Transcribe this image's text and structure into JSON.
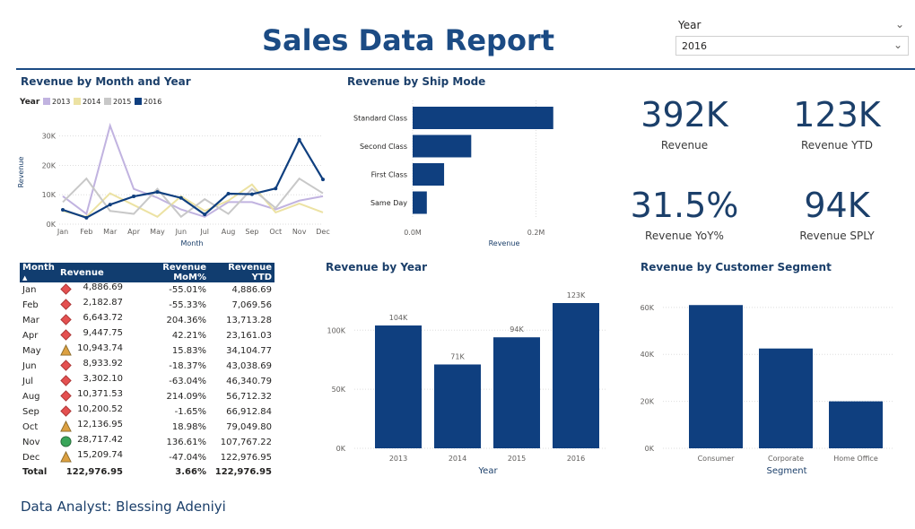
{
  "title": "Sales Data Report",
  "slicer": {
    "label": "Year",
    "value": "2016"
  },
  "analyst": "Data Analyst: Blessing Adeniyi",
  "kpis": [
    {
      "value": "392K",
      "label": "Revenue"
    },
    {
      "value": "123K",
      "label": "Revenue YTD"
    },
    {
      "value": "31.5%",
      "label": "Revenue YoY%"
    },
    {
      "value": "94K",
      "label": "Revenue SPLY"
    }
  ],
  "colors": {
    "primary": "#0f3f7f",
    "c2013": "#c1b3e0",
    "c2014": "#ece2a3",
    "c2015": "#c8c8c8",
    "c2016": "#0f3f7f",
    "red": "#e45050",
    "amber": "#dca041",
    "green": "#3aa65a"
  },
  "matrix": {
    "headers": [
      "Month",
      "Revenue",
      "Revenue MoM%",
      "Revenue YTD"
    ],
    "rows": [
      {
        "month": "Jan",
        "icon": "red-diamond",
        "revenue": "4,886.69",
        "mom": "-55.01%",
        "ytd": "4,886.69"
      },
      {
        "month": "Feb",
        "icon": "red-diamond",
        "revenue": "2,182.87",
        "mom": "-55.33%",
        "ytd": "7,069.56"
      },
      {
        "month": "Mar",
        "icon": "red-diamond",
        "revenue": "6,643.72",
        "mom": "204.36%",
        "ytd": "13,713.28"
      },
      {
        "month": "Apr",
        "icon": "red-diamond",
        "revenue": "9,447.75",
        "mom": "42.21%",
        "ytd": "23,161.03"
      },
      {
        "month": "May",
        "icon": "amber-triangle",
        "revenue": "10,943.74",
        "mom": "15.83%",
        "ytd": "34,104.77"
      },
      {
        "month": "Jun",
        "icon": "red-diamond",
        "revenue": "8,933.92",
        "mom": "-18.37%",
        "ytd": "43,038.69"
      },
      {
        "month": "Jul",
        "icon": "red-diamond",
        "revenue": "3,302.10",
        "mom": "-63.04%",
        "ytd": "46,340.79"
      },
      {
        "month": "Aug",
        "icon": "red-diamond",
        "revenue": "10,371.53",
        "mom": "214.09%",
        "ytd": "56,712.32"
      },
      {
        "month": "Sep",
        "icon": "red-diamond",
        "revenue": "10,200.52",
        "mom": "-1.65%",
        "ytd": "66,912.84"
      },
      {
        "month": "Oct",
        "icon": "amber-triangle",
        "revenue": "12,136.95",
        "mom": "18.98%",
        "ytd": "79,049.80"
      },
      {
        "month": "Nov",
        "icon": "green-circle",
        "revenue": "28,717.42",
        "mom": "136.61%",
        "ytd": "107,767.22"
      },
      {
        "month": "Dec",
        "icon": "amber-triangle",
        "revenue": "15,209.74",
        "mom": "-47.04%",
        "ytd": "122,976.95"
      }
    ],
    "total": {
      "month": "Total",
      "revenue": "122,976.95",
      "mom": "3.66%",
      "ytd": "122,976.95"
    }
  },
  "chart_data": [
    {
      "type": "line",
      "title": "Revenue by Month and Year",
      "xlabel": "Month",
      "ylabel": "Revenue",
      "legend_title": "Year",
      "legend_position": "top-left",
      "categories": [
        "Jan",
        "Feb",
        "Mar",
        "Apr",
        "May",
        "Jun",
        "Jul",
        "Aug",
        "Sep",
        "Oct",
        "Nov",
        "Dec"
      ],
      "yticks": [
        "0K",
        "10K",
        "20K",
        "30K"
      ],
      "ylim": [
        0,
        36000
      ],
      "grid": true,
      "series": [
        {
          "name": "2013",
          "values": [
            9500,
            3500,
            33500,
            12000,
            9000,
            5000,
            2500,
            7500,
            7500,
            5000,
            8000,
            9500
          ]
        },
        {
          "name": "2014",
          "values": [
            4500,
            2500,
            10500,
            6500,
            2500,
            9500,
            4500,
            8000,
            13500,
            4000,
            7000,
            4000
          ]
        },
        {
          "name": "2015",
          "values": [
            7500,
            15500,
            4500,
            3500,
            12000,
            2500,
            8500,
            3500,
            12000,
            5500,
            15500,
            10500
          ]
        },
        {
          "name": "2016",
          "values": [
            4887,
            2183,
            6644,
            9448,
            10944,
            8934,
            3302,
            10372,
            10201,
            12137,
            28717,
            15210
          ]
        }
      ]
    },
    {
      "type": "bar",
      "orientation": "horizontal",
      "title": "Revenue by Ship Mode",
      "xlabel": "Revenue",
      "categories": [
        "Standard Class",
        "Second Class",
        "First Class",
        "Same Day"
      ],
      "values": [
        228000,
        95000,
        51000,
        23000
      ],
      "xticks": [
        "0.0M",
        "0.2M"
      ],
      "xlim": [
        0,
        400000
      ]
    },
    {
      "type": "bar",
      "title": "Revenue by Year",
      "xlabel": "Year",
      "categories": [
        "2013",
        "2014",
        "2015",
        "2016"
      ],
      "values": [
        104000,
        71000,
        94000,
        123000
      ],
      "data_labels": [
        "104K",
        "71K",
        "94K",
        "123K"
      ],
      "yticks": [
        "0K",
        "50K",
        "100K"
      ],
      "ylim": [
        0,
        123000
      ]
    },
    {
      "type": "bar",
      "title": "Revenue by Customer Segment",
      "xlabel": "Segment",
      "categories": [
        "Consumer",
        "Corporate",
        "Home Office"
      ],
      "values": [
        61000,
        42500,
        20000
      ],
      "yticks": [
        "0K",
        "20K",
        "40K",
        "60K"
      ],
      "ylim": [
        0,
        63000
      ]
    }
  ]
}
